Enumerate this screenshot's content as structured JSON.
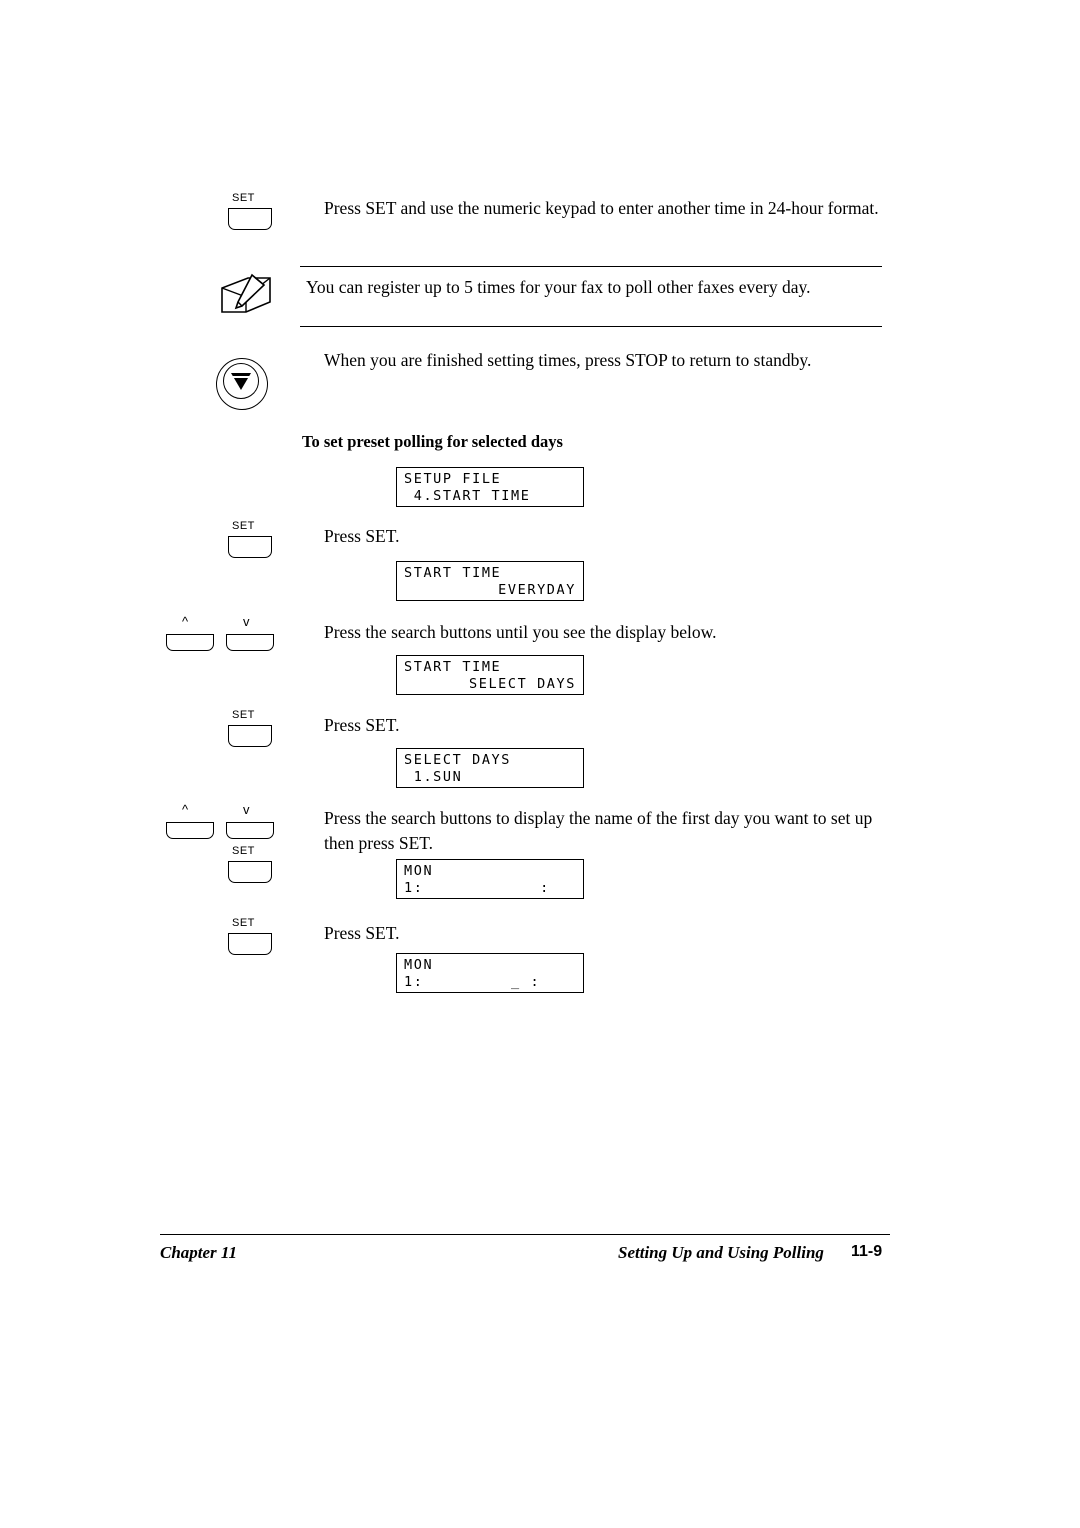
{
  "document": {
    "steps": [
      {
        "icon": "set-key",
        "key_label": "SET",
        "text": "Press SET and use the numeric keypad to enter another time in 24-hour format."
      },
      {
        "icon": "note-pencil",
        "text": "You can register up to 5 times for your fax to poll other faxes every day."
      },
      {
        "icon": "stop-key",
        "text": "When you are finished setting times, press STOP to return to standby."
      }
    ],
    "section_heading": "To set preset polling for selected days",
    "key_labels": {
      "set": "SET",
      "arrow_up": "^",
      "arrow_down": "v"
    },
    "lcd_screens": [
      {
        "line1": "SETUP FILE",
        "line2": " 4.START TIME",
        "align": "left"
      },
      {
        "line1": "START TIME",
        "line2": "EVERYDAY",
        "align": "right"
      },
      {
        "line1": "START TIME",
        "line2": "SELECT DAYS",
        "align": "right"
      },
      {
        "line1": "SELECT DAYS",
        "line2": " 1.SUN",
        "align": "left"
      },
      {
        "line1": "MON",
        "line2": "1:            :",
        "align": "left"
      },
      {
        "line1": "MON",
        "line2": "1:         _ :",
        "align": "left"
      }
    ],
    "instructions": [
      "Press SET.",
      "Press the search buttons until you see the display below.",
      "Press SET.",
      "Press the search buttons to display the name of the first day you want to set up then press SET.",
      "Press SET."
    ],
    "footer": {
      "left": "Chapter 11",
      "center": "Setting Up and Using Polling",
      "page": "11-9"
    }
  }
}
